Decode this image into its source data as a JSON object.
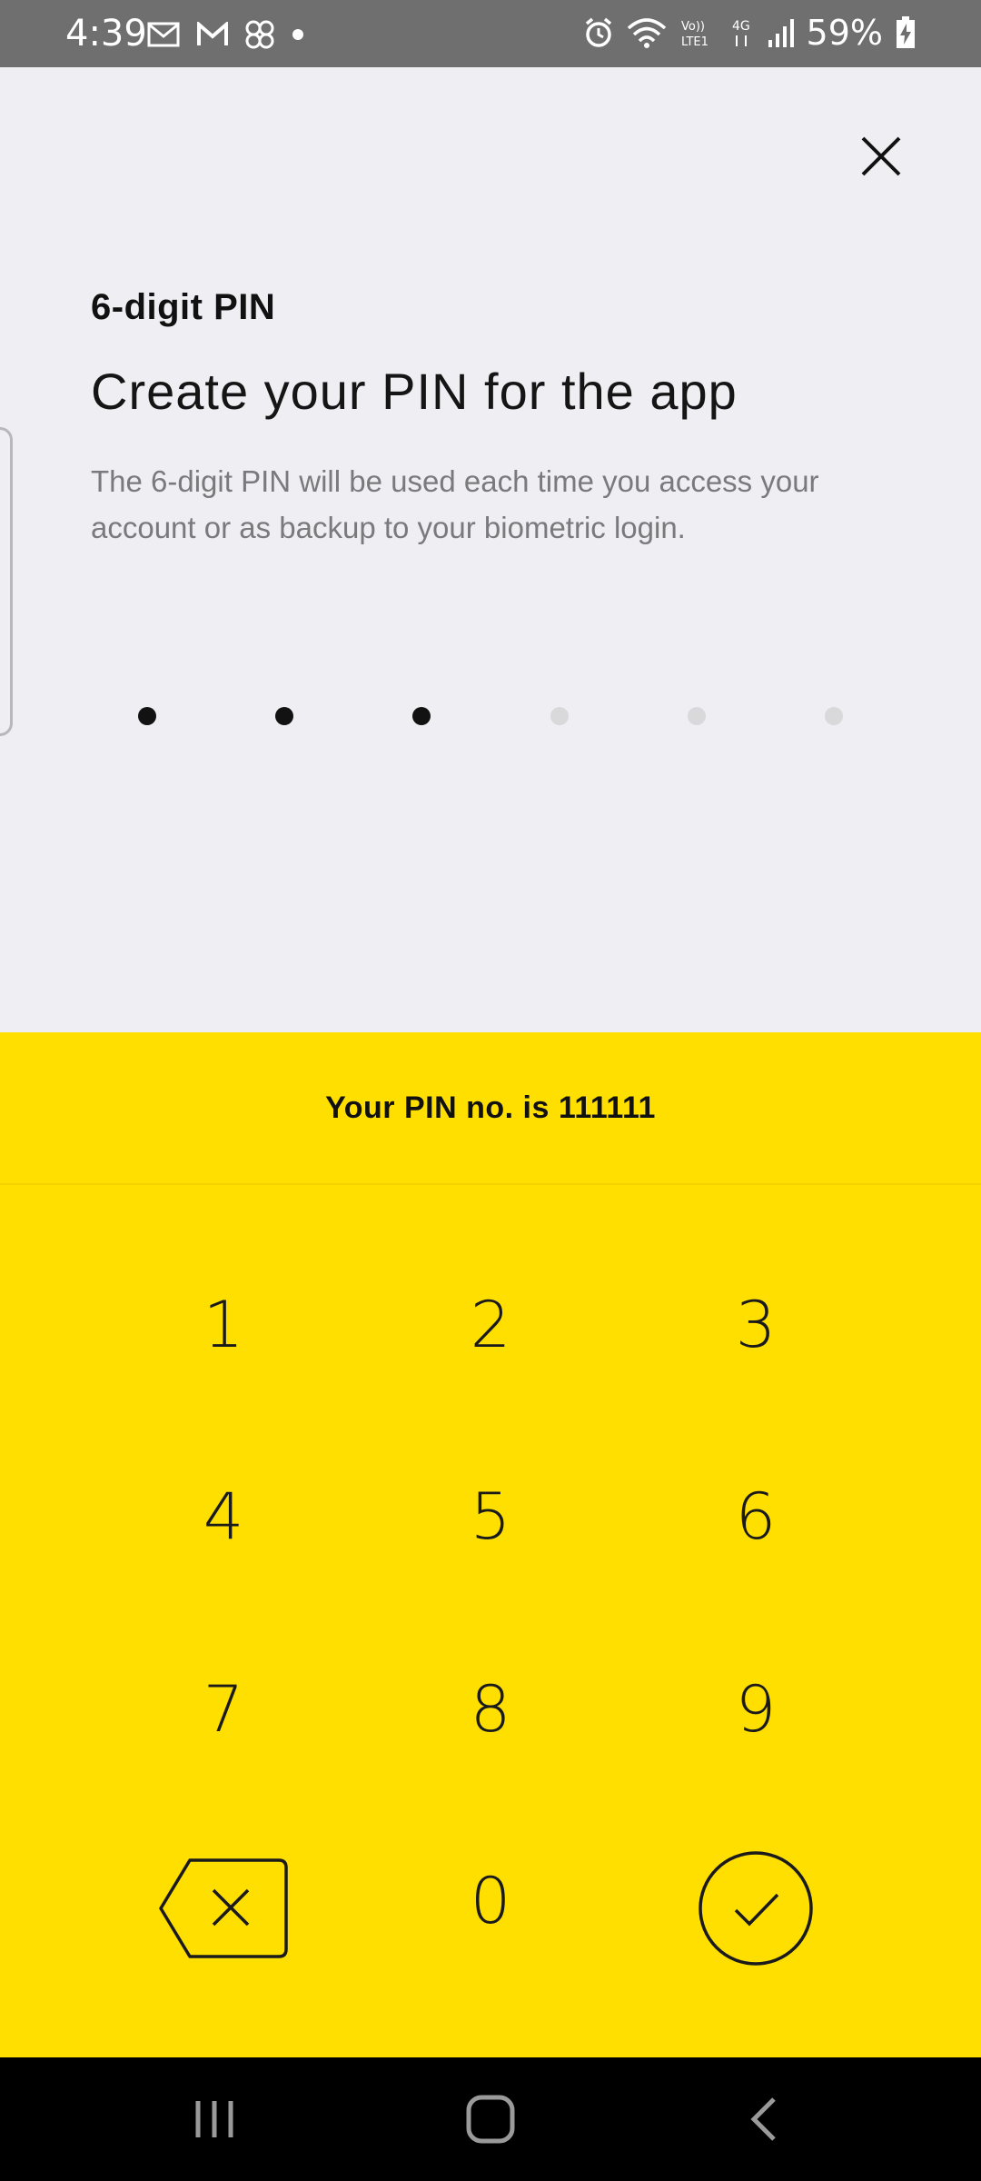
{
  "status_bar": {
    "time": "4:39",
    "battery": "59%",
    "left_icons": [
      "mail-icon",
      "gmail-icon",
      "app-icon",
      "dot-icon"
    ],
    "right_icons": [
      "alarm-icon",
      "wifi-icon",
      "volte-icon",
      "4g-icon",
      "signal-icon",
      "battery-charging-icon"
    ]
  },
  "header": {
    "close_icon": "close-icon"
  },
  "content": {
    "pin_label": "6-digit PIN",
    "heading": "Create your PIN for the app",
    "description": "The 6-digit PIN will be used each time you access your account or as backup to your biometric login."
  },
  "pin": {
    "length": 6,
    "filled": 3
  },
  "banner": {
    "text": "Your PIN no. is 111111"
  },
  "keypad": {
    "keys": [
      "1",
      "2",
      "3",
      "4",
      "5",
      "6",
      "7",
      "8",
      "9",
      "backspace",
      "0",
      "confirm"
    ]
  },
  "colors": {
    "accent": "#ffdf00",
    "background": "#efeef3",
    "text": "#151515",
    "muted": "#7a7a7c"
  }
}
